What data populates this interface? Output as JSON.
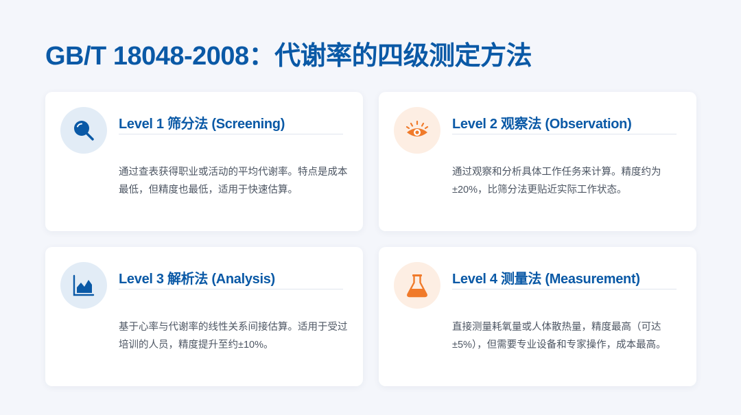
{
  "title": "GB/T 18048-2008：代谢率的四级测定方法",
  "colors": {
    "primary": "#0a59a6",
    "accent_orange": "#f07a2a",
    "background": "#f4f6fb"
  },
  "cards": [
    {
      "title": "Level 1 筛分法 (Screening)",
      "description": "通过查表获得职业或活动的平均代谢率。特点是成本最低，但精度也最低，适用于快速估算。",
      "icon": "magnifier-icon"
    },
    {
      "title": "Level 2 观察法 (Observation)",
      "description": "通过观察和分析具体工作任务来计算。精度约为±20%，比筛分法更贴近实际工作状态。",
      "icon": "eye-icon"
    },
    {
      "title": "Level 3 解析法 (Analysis)",
      "description": "基于心率与代谢率的线性关系间接估算。适用于受过培训的人员，精度提升至约±10%。",
      "icon": "area-chart-icon"
    },
    {
      "title": "Level 4 测量法 (Measurement)",
      "description": "直接测量耗氧量或人体散热量，精度最高（可达±5%），但需要专业设备和专家操作，成本最高。",
      "icon": "flask-icon"
    }
  ]
}
